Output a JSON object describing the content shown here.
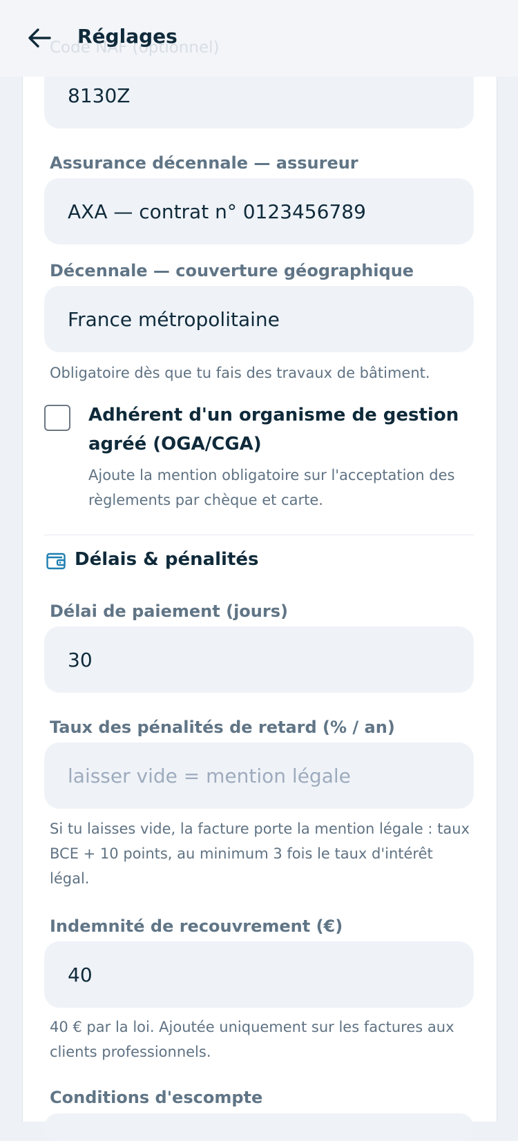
{
  "header": {
    "title": "Réglages",
    "ghost_text": "Code NAF (optionnel)"
  },
  "fields": {
    "naf": {
      "value": "8130Z"
    },
    "assurance": {
      "label": "Assurance décennale — assureur",
      "value": "AXA — contrat n° 0123456789"
    },
    "couverture": {
      "label": "Décennale — couverture géographique",
      "value": "France métropolitaine",
      "help": "Obligatoire dès que tu fais des travaux de bâtiment."
    },
    "oga": {
      "label": "Adhérent d'un organisme de gestion agréé (OGA/CGA)",
      "help": "Ajoute la mention obligatoire sur l'acceptation des règlements par chèque et carte.",
      "checked": false
    },
    "delai": {
      "label": "Délai de paiement (jours)",
      "value": "30"
    },
    "taux": {
      "label": "Taux des pénalités de retard (% / an)",
      "placeholder": "laisser vide = mention légale",
      "help": "Si tu laisses vide, la facture porte la mention légale : taux BCE + 10 points, au minimum 3 fois le taux d'intérêt légal."
    },
    "indemnite": {
      "label": "Indemnité de recouvrement (€)",
      "value": "40",
      "help": "40 € par la loi. Ajoutée uniquement sur les factures aux clients professionnels."
    },
    "escompte": {
      "label": "Conditions d'escompte"
    }
  },
  "section": {
    "title": "Délais & pénalités",
    "icon": "wallet-icon"
  },
  "colors": {
    "accent": "#1e7fb0",
    "field_bg": "#eff3f8",
    "text": "#0f2a3a",
    "label": "#607586"
  }
}
